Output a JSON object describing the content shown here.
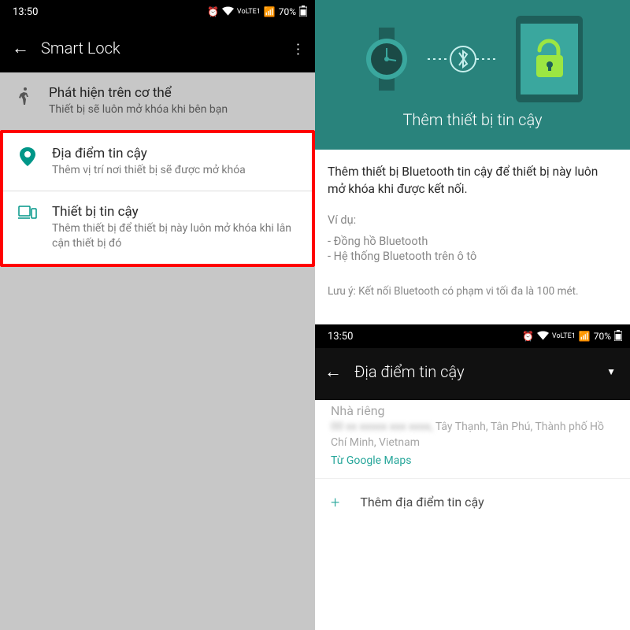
{
  "status": {
    "time": "13:50",
    "battery": "70%",
    "network": "VoLTE1"
  },
  "left": {
    "title": "Smart Lock",
    "items": [
      {
        "title": "Phát hiện trên cơ thể",
        "sub": "Thiết bị sẽ luôn mở khóa khi bên bạn"
      },
      {
        "title": "Địa điểm tin cậy",
        "sub": "Thêm vị trí nơi thiết bị sẽ được mở khóa"
      },
      {
        "title": "Thiết bị tin cậy",
        "sub": "Thêm thiết bị để thiết bị này luôn mở khóa khi lân cận thiết bị đó"
      }
    ]
  },
  "right_top": {
    "heading": "Thêm thiết bị tin cậy",
    "main": "Thêm thiết bị Bluetooth tin cậy để thiết bị này luôn mở khóa khi được kết nối.",
    "example_label": "Ví dụ:",
    "example_1": "- Đồng hồ Bluetooth",
    "example_2": "- Hệ thống Bluetooth trên ô tô",
    "note": "Lưu ý: Kết nối Bluetooth có phạm vi tối đa là 100 mét."
  },
  "right_bot": {
    "title": "Địa điểm tin cậy",
    "home_label": "Nhà riêng",
    "addr": "Tây Thạnh, Tân Phú, Thành phố Hồ Chí Minh, Vietnam",
    "from": "Từ Google Maps",
    "add_label": "Thêm địa điểm tin cậy"
  }
}
